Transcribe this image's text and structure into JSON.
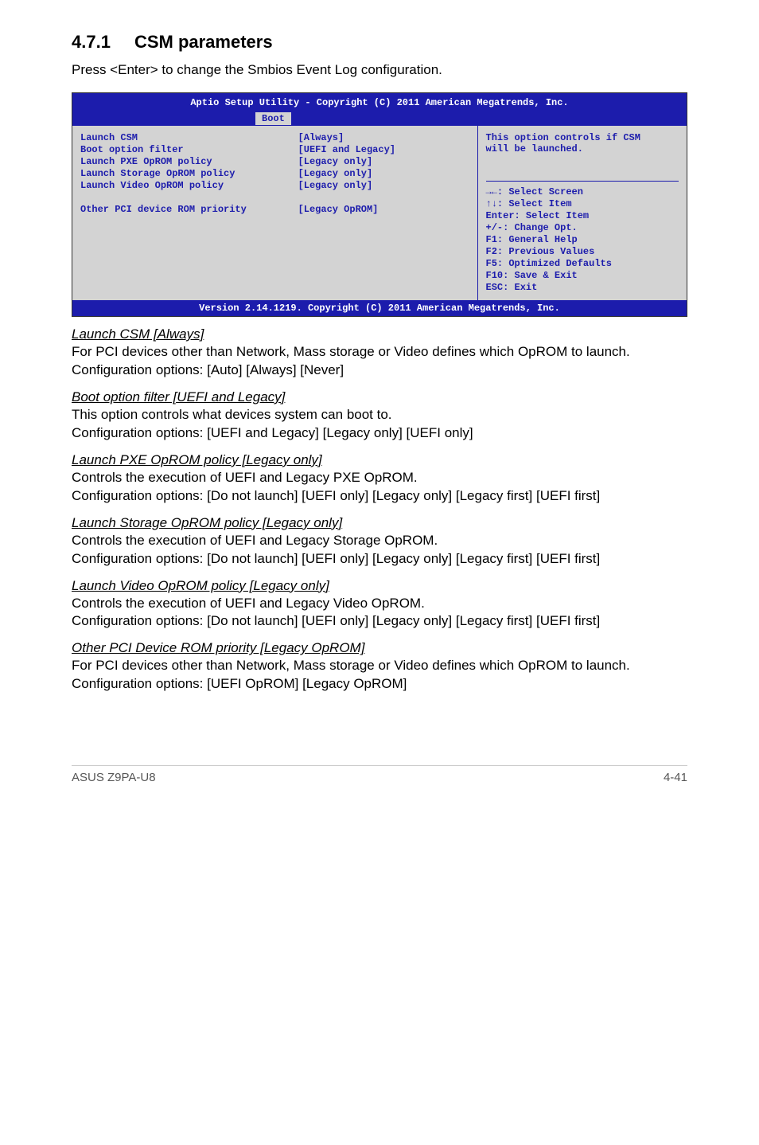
{
  "section": {
    "number": "4.7.1",
    "title": "CSM parameters"
  },
  "intro": "Press <Enter> to change the Smbios Event Log configuration.",
  "bios": {
    "header": "Aptio Setup Utility - Copyright (C) 2011 American Megatrends, Inc.",
    "tab": "Boot",
    "rows": [
      {
        "label": "Launch CSM",
        "value": "[Always]"
      },
      {
        "label": "Boot option filter",
        "value": "[UEFI and Legacy]"
      },
      {
        "label": "Launch PXE OpROM policy",
        "value": "[Legacy only]"
      },
      {
        "label": "Launch Storage OpROM policy",
        "value": "[Legacy only]"
      },
      {
        "label": "Launch Video OpROM policy",
        "value": "[Legacy only]"
      },
      {
        "label": "",
        "value": ""
      },
      {
        "label": "Other PCI device ROM priority",
        "value": "[Legacy OpROM]"
      }
    ],
    "help_top1": "This option controls if CSM",
    "help_top2": "will be launched.",
    "help_keys": [
      "→←: Select Screen",
      "↑↓:  Select Item",
      "Enter: Select Item",
      "+/-: Change Opt.",
      "F1: General Help",
      "F2: Previous Values",
      "F5: Optimized Defaults",
      "F10: Save & Exit",
      "ESC: Exit"
    ],
    "footer": "Version 2.14.1219. Copyright (C) 2011 American Megatrends, Inc."
  },
  "items": [
    {
      "title": "Launch CSM [Always]",
      "lines": [
        "For PCI devices other than Network, Mass storage or Video defines which OpROM to launch.",
        "Configuration options: [Auto] [Always] [Never]"
      ]
    },
    {
      "title": "Boot option filter [UEFI and Legacy]",
      "lines": [
        "This option controls what devices system can boot to.",
        "Configuration options: [UEFI and Legacy]  [Legacy only] [UEFI only]"
      ]
    },
    {
      "title": "Launch PXE OpROM policy [Legacy only]",
      "lines": [
        "Controls the execution of UEFI and Legacy PXE OpROM.",
        "Configuration options: [Do not launch] [UEFI only] [Legacy only] [Legacy first] [UEFI first]"
      ]
    },
    {
      "title": "Launch Storage OpROM policy [Legacy only]",
      "lines": [
        "Controls the execution of UEFI and Legacy Storage OpROM.",
        "Configuration options: [Do not launch] [UEFI only] [Legacy only] [Legacy first] [UEFI first]"
      ]
    },
    {
      "title": "Launch Video OpROM policy [Legacy only]",
      "lines": [
        "Controls the execution of UEFI and Legacy Video OpROM.",
        "Configuration options: [Do not launch] [UEFI only] [Legacy only] [Legacy first] [UEFI first]"
      ]
    },
    {
      "title": "Other PCI Device ROM priority [Legacy OpROM]",
      "lines": [
        "For PCI devices other than Network, Mass storage or Video defines which OpROM to launch.",
        "Configuration options: [UEFI OpROM] [Legacy OpROM]"
      ]
    }
  ],
  "footer": {
    "left": "ASUS Z9PA-U8",
    "right": "4-41"
  }
}
